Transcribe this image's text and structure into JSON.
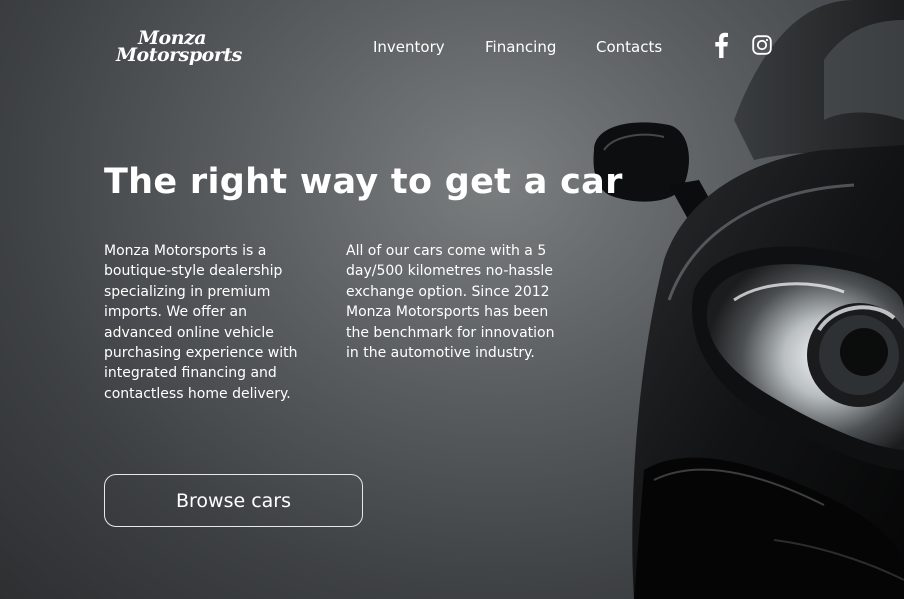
{
  "brand": {
    "line1": "Monza",
    "line2": "Motorsports"
  },
  "nav": {
    "items": [
      {
        "label": "Inventory"
      },
      {
        "label": "Financing"
      },
      {
        "label": "Contacts"
      }
    ]
  },
  "social": {
    "icons": [
      "facebook-icon",
      "instagram-icon"
    ]
  },
  "hero": {
    "title": "The right way to get a car",
    "paragraph1": "Monza Motorsports is a boutique-style dealership specializing in premium imports. We offer an advanced online vehicle purchasing experience with integrated financing and contactless home delivery.",
    "paragraph2": "All of our cars come with a 5 day/500 kilometres no-hassle exchange option. Since 2012 Monza Motorsports has been the benchmark for innovation in the automotive industry.",
    "cta_label": "Browse cars"
  },
  "colors": {
    "text": "#ffffff",
    "background_center": "#7a7e7f",
    "background_edge": "#2d2f31",
    "button_border": "#e8e8e8"
  }
}
